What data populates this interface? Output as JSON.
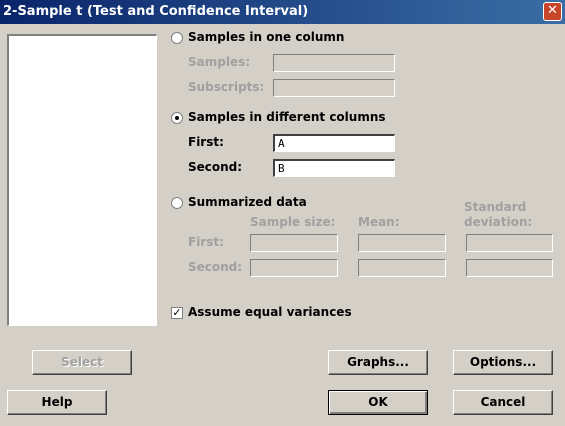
{
  "window": {
    "title": "2-Sample t (Test and Confidence Interval)",
    "close_glyph": "✕"
  },
  "one_column": {
    "label": "Samples in one column",
    "samples_label": "Samples:",
    "subscripts_label": "Subscripts:"
  },
  "different_columns": {
    "label": "Samples in different columns",
    "first_label": "First:",
    "first_value": "A",
    "second_label": "Second:",
    "second_value": "B"
  },
  "summarized": {
    "label": "Summarized data",
    "col_size": "Sample size:",
    "col_mean": "Mean:",
    "col_sd_1": "Standard",
    "col_sd_2": "deviation:",
    "first_label": "First:",
    "second_label": "Second:"
  },
  "equal_var": {
    "label": "Assume equal variances",
    "checked": true,
    "check_glyph": "✓"
  },
  "buttons": {
    "select": "Select",
    "graphs": "Graphs...",
    "options": "Options...",
    "help": "Help",
    "ok": "OK",
    "cancel": "Cancel"
  }
}
